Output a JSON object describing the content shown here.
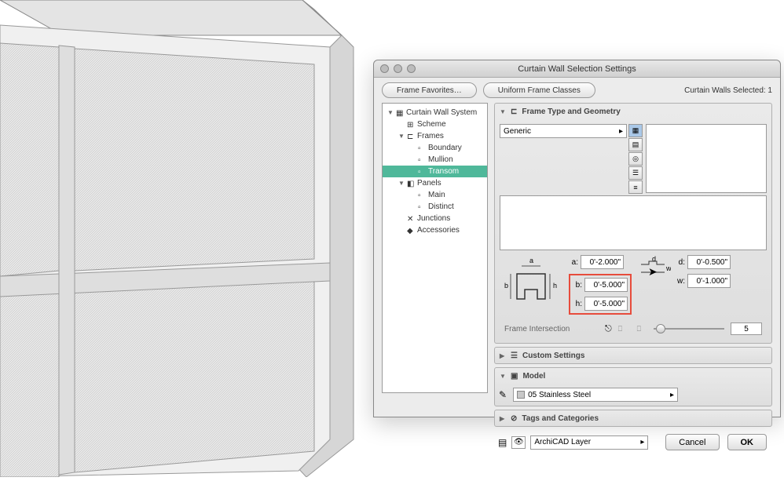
{
  "dialog": {
    "title": "Curtain Wall Selection Settings",
    "favorites_btn": "Frame Favorites…",
    "uniform_btn": "Uniform Frame Classes",
    "selected_label": "Curtain Walls Selected: 1"
  },
  "tree": {
    "root": "Curtain Wall System",
    "scheme": "Scheme",
    "frames": "Frames",
    "boundary": "Boundary",
    "mullion": "Mullion",
    "transom": "Transom",
    "panels": "Panels",
    "main": "Main",
    "distinct": "Distinct",
    "junctions": "Junctions",
    "accessories": "Accessories"
  },
  "sections": {
    "type_geom": "Frame Type and Geometry",
    "custom": "Custom Settings",
    "model": "Model",
    "tags": "Tags and Categories"
  },
  "frame_type": {
    "selected": "Generic"
  },
  "dims": {
    "a_lbl": "a:",
    "a_val": "0'-2.000\"",
    "b_lbl": "b:",
    "b_val": "0'-5.000\"",
    "h_lbl": "h:",
    "h_val": "0'-5.000\"",
    "d_lbl": "d:",
    "d_val": "0'-0.500\"",
    "w_lbl": "w:",
    "w_val": "0'-1.000\"",
    "diag_a": "a",
    "diag_b": "b",
    "diag_h": "h",
    "diag_d": "d",
    "diag_w": "w"
  },
  "intersection": {
    "label": "Frame Intersection",
    "value": "5"
  },
  "model": {
    "material": "05 Stainless Steel"
  },
  "layer": {
    "name": "ArchiCAD Layer"
  },
  "buttons": {
    "cancel": "Cancel",
    "ok": "OK"
  }
}
